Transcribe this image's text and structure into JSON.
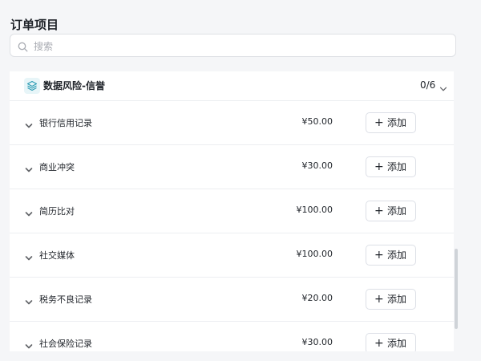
{
  "header": {
    "title": "订单项目"
  },
  "search": {
    "placeholder": "搜索",
    "value": ""
  },
  "group": {
    "name": "数据风险-信誉",
    "count": "0/6",
    "icon": "layers-icon"
  },
  "add_label": "添加",
  "items": [
    {
      "name": "银行信用记录",
      "price": "¥50.00"
    },
    {
      "name": "商业冲突",
      "price": "¥30.00"
    },
    {
      "name": "简历比对",
      "price": "¥100.00"
    },
    {
      "name": "社交媒体",
      "price": "¥100.00"
    },
    {
      "name": "税务不良记录",
      "price": "¥20.00"
    },
    {
      "name": "社会保险记录",
      "price": "¥30.00"
    }
  ],
  "colors": {
    "accent_icon": "#2a9bb3",
    "border": "#dfe1e5",
    "background": "#f5f6f8"
  }
}
